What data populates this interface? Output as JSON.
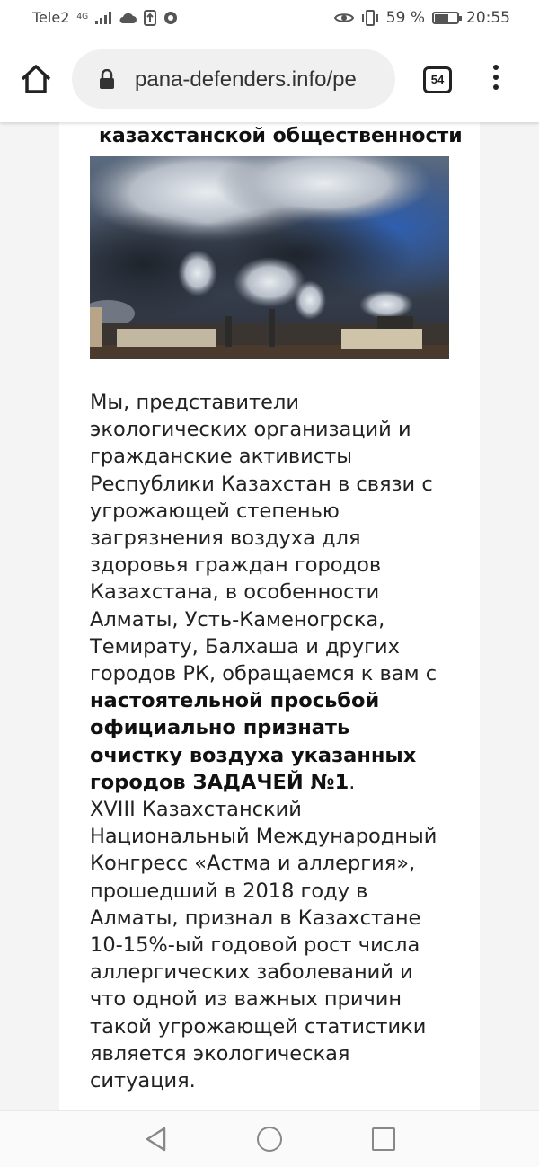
{
  "status_bar": {
    "carrier": "Tele2",
    "network": "4G",
    "battery_percent": "59 %",
    "time": "20:55"
  },
  "browser": {
    "url": "pana-defenders.info/pe",
    "tab_count": "54"
  },
  "article": {
    "heading": "казахстанской общественности",
    "photo_icon": "industrial-smoke-photo",
    "paragraph1_intro": "Мы, представители экологических организаций и гражданские активисты Республики Казахстан  в связи с угрожающей степенью загрязнения воздуха для здоровья граждан городов Казахстана, в особенности Алматы, Усть-Каменогрска, Темирату, Балхаша и других городов РК, обращаемся к вам с ",
    "paragraph1_bold": "настоятельной просьбой официально признать очистку воздуха указанных городов ЗАДАЧЕЙ №1",
    "paragraph1_end": ".",
    "paragraph2": "XVIII Казахстанский Национальный Международный Конгресс «Астма и аллергия», прошедший в 2018 году в Алматы, признал в Казахстане 10-15%-ый годовой рост числа аллергических заболеваний и что одной из важных причин такой угрожающей статистики является экологическая ситуация."
  },
  "colors": {
    "accent": "#222222",
    "url_bar": "#f0f0f0"
  }
}
